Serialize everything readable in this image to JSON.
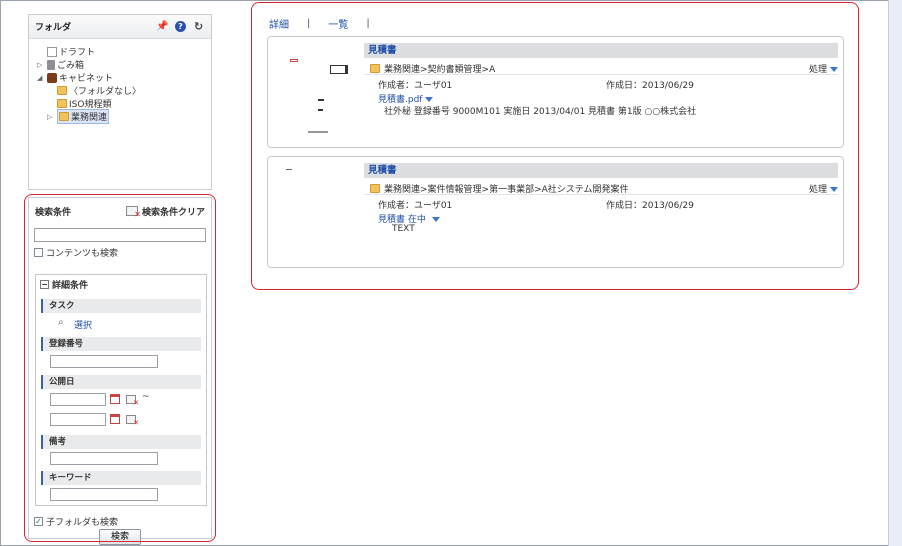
{
  "folder_panel": {
    "title": "フォルダ",
    "tree": [
      {
        "label": "ドラフト",
        "icon": "draft-icon"
      },
      {
        "label": "ごみ箱",
        "icon": "trash-icon"
      },
      {
        "label": "キャビネット",
        "icon": "cabinet-icon"
      },
      {
        "label": "〈フォルダなし〉",
        "icon": "folder-icon"
      },
      {
        "label": "ISO規程類",
        "icon": "folder-icon"
      },
      {
        "label": "業務関連",
        "icon": "folder-icon",
        "selected": true
      }
    ]
  },
  "search": {
    "title": "検索条件",
    "clear_label": "検索条件クリア",
    "keyword_value": "",
    "include_contents_label": "コンテンツも検索",
    "detail_title": "詳細条件",
    "task_label": "タスク",
    "task_select_label": "選択",
    "reg_no_label": "登録番号",
    "publish_date_label": "公開日",
    "tilde": "~",
    "note_label": "備考",
    "keyword_label": "キーワード",
    "include_subfolders_label": "子フォルダも検索",
    "include_subfolders_checked": true,
    "search_button": "検索"
  },
  "view": {
    "tabs": [
      "詳細",
      "一覧"
    ],
    "separator": "|"
  },
  "results": [
    {
      "title": "見積書",
      "path": "業務関連>契約書類管理>A",
      "action": "処理",
      "creator": "作成者：ユーザ01",
      "created": "作成日：2013/06/29",
      "file": "見積書.pdf",
      "description": "社外秘  登録番号 9000M101  実施日 2013/04/01 見積書 第1版 ○○株式会社"
    },
    {
      "title": "見積書",
      "path": "業務関連>案件情報管理>第一事業部>A社システム開発案件",
      "action": "処理",
      "creator": "作成者：ユーザ01",
      "created": "作成日：2013/06/29",
      "file": "見積書 在中",
      "description": "TEXT"
    }
  ],
  "colors": {
    "highlight_border": "#d8262f",
    "link": "#1f4fa8"
  }
}
